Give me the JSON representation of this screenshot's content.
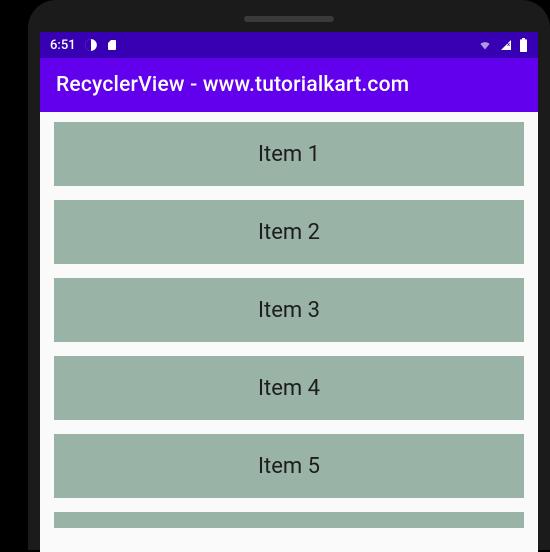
{
  "status": {
    "time": "6:51",
    "icons": {
      "left1": "contrast-icon",
      "left2": "sd-card-icon",
      "wifi": "wifi-icon",
      "signal": "signal-icon",
      "battery": "battery-icon"
    }
  },
  "appbar": {
    "title": "RecyclerView - www.tutorialkart.com"
  },
  "list": {
    "items": [
      {
        "label": "Item 1"
      },
      {
        "label": "Item 2"
      },
      {
        "label": "Item 3"
      },
      {
        "label": "Item 4"
      },
      {
        "label": "Item 5"
      },
      {
        "label": ""
      }
    ]
  },
  "colors": {
    "primary": "#6200EE",
    "dark": "#3700B3",
    "item": "#9AB3A7",
    "bg": "#fafafa"
  }
}
